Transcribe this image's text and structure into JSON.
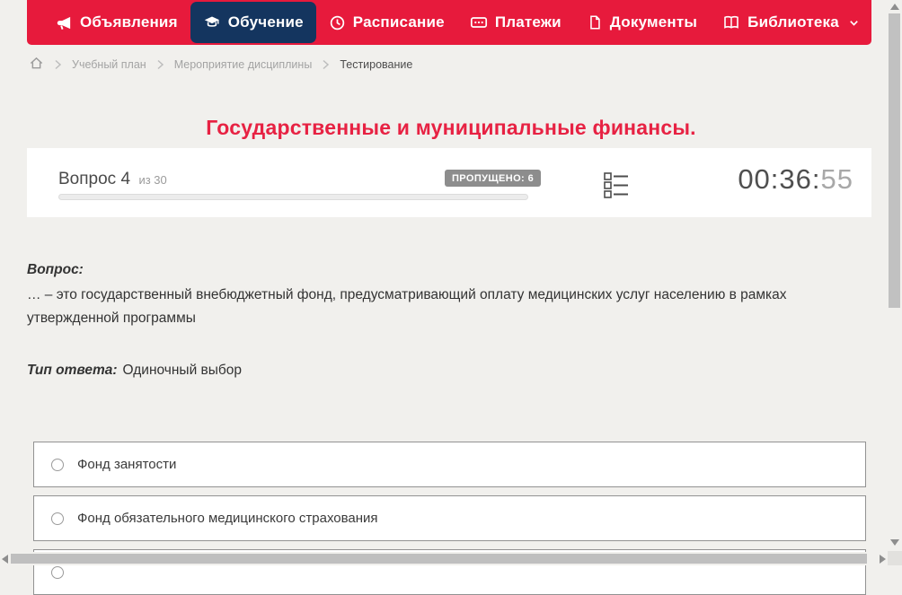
{
  "nav": {
    "items": [
      {
        "label": "Объявления",
        "icon": "megaphone-icon",
        "active": false
      },
      {
        "label": "Обучение",
        "icon": "graduation-cap-icon",
        "active": true
      },
      {
        "label": "Расписание",
        "icon": "clock-icon",
        "active": false
      },
      {
        "label": "Платежи",
        "icon": "banknote-icon",
        "active": false
      },
      {
        "label": "Документы",
        "icon": "document-icon",
        "active": false
      },
      {
        "label": "Библиотека",
        "icon": "open-book-icon",
        "active": false,
        "has_dropdown": true
      }
    ]
  },
  "breadcrumb": {
    "items": [
      "Учебный план",
      "Мероприятие дисциплины",
      "Тестирование"
    ]
  },
  "page": {
    "title": "Государственные и муниципальные финансы."
  },
  "question_panel": {
    "question_label": "Вопрос 4",
    "question_total": "из 30",
    "skipped_badge": "ПРОПУЩЕНО: 6",
    "timer_main": "00:36:",
    "timer_seconds": "55",
    "progress_percent": 0
  },
  "question": {
    "label": "Вопрос:",
    "text": "… – это государственный внебюджетный фонд, предусматривающий оплату медицинских услуг населению в рамках утвержденной программы",
    "answer_type_label": "Тип ответа:",
    "answer_type_value": "Одиночный выбор"
  },
  "answers": {
    "options": [
      {
        "label": "Фонд занятости",
        "selected": false
      },
      {
        "label": "Фонд обязательного медицинского страхования",
        "selected": false
      },
      {
        "label": "",
        "selected": false
      }
    ]
  },
  "colors": {
    "nav_background": "#e71a3c",
    "nav_active_background": "#14355f",
    "title_red": "#e72243",
    "page_background": "#f1f0ed",
    "badge_gray": "#8d8d8d"
  }
}
